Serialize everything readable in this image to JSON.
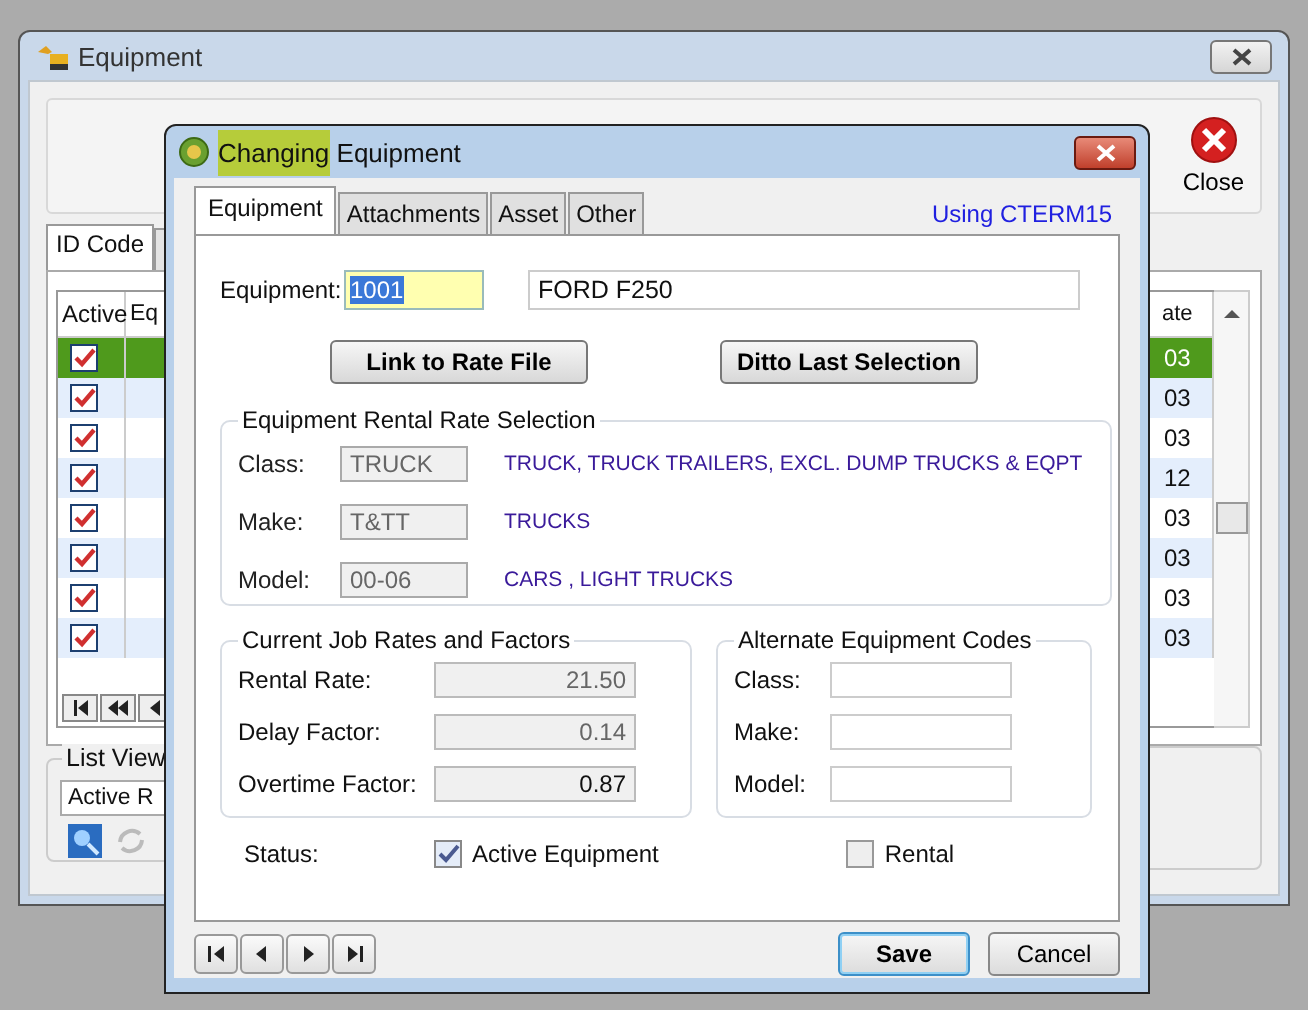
{
  "main_window": {
    "title": "Equipment",
    "toolbar": {
      "close_label": "Close"
    },
    "tabs": [
      {
        "label": "ID Code",
        "selected": true
      }
    ],
    "grid": {
      "columns": [
        "Active",
        "Eq",
        "ate"
      ],
      "rows": [
        {
          "active": true,
          "selected": true,
          "column_3": "03"
        },
        {
          "active": true,
          "selected": false,
          "column_3": "03"
        },
        {
          "active": true,
          "selected": false,
          "column_3": "03"
        },
        {
          "active": true,
          "selected": false,
          "column_3": "12"
        },
        {
          "active": true,
          "selected": false,
          "column_3": "03"
        },
        {
          "active": true,
          "selected": false,
          "column_3": "03"
        },
        {
          "active": true,
          "selected": false,
          "column_3": "03"
        },
        {
          "active": true,
          "selected": false,
          "column_3": "03"
        }
      ]
    },
    "list_view": {
      "label": "List View",
      "value": "Active R"
    }
  },
  "dialog": {
    "title": [
      {
        "text": "Changing",
        "highlighted": true
      },
      {
        "text": " Equipment",
        "highlighted": false
      }
    ],
    "tabs": [
      {
        "label": "Equipment",
        "selected": true
      },
      {
        "label": "Attachments",
        "selected": false
      },
      {
        "label": "Asset",
        "selected": false
      },
      {
        "label": "Other",
        "selected": false
      }
    ],
    "using": "Using CTERM15",
    "equipment": {
      "label": "Equipment:",
      "value": "1001",
      "description": "FORD F250"
    },
    "buttons": [
      "Link to Rate File",
      "Ditto Last Selection"
    ],
    "rate_selection": {
      "title": "Equipment Rental Rate Selection",
      "rows": [
        {
          "label": "Class:",
          "value": "TRUCK",
          "description": "TRUCK, TRUCK TRAILERS, EXCL. DUMP TRUCKS & EQPT"
        },
        {
          "label": "Make:",
          "value": "T&TT",
          "description": "TRUCKS"
        },
        {
          "label": "Model:",
          "value": "00-06",
          "description": "CARS , LIGHT TRUCKS"
        }
      ]
    },
    "job_rates": {
      "title": "Current Job Rates and Factors",
      "rows": [
        {
          "label": "Rental Rate:",
          "value": "21.50",
          "disabled": true
        },
        {
          "label": "Delay Factor:",
          "value": "0.14",
          "disabled": true
        },
        {
          "label": "Overtime Factor:",
          "value": "0.87",
          "disabled": false
        }
      ]
    },
    "alternate_codes": {
      "title": "Alternate Equipment Codes",
      "rows": [
        {
          "label": "Class:"
        },
        {
          "label": "Make:"
        },
        {
          "label": "Model:"
        }
      ]
    },
    "status": {
      "label": "Status:",
      "options": [
        {
          "label": "Active Equipment",
          "checked": true
        },
        {
          "label": "Rental",
          "checked": false
        }
      ]
    },
    "actions": [
      "Save",
      "Cancel"
    ]
  }
}
